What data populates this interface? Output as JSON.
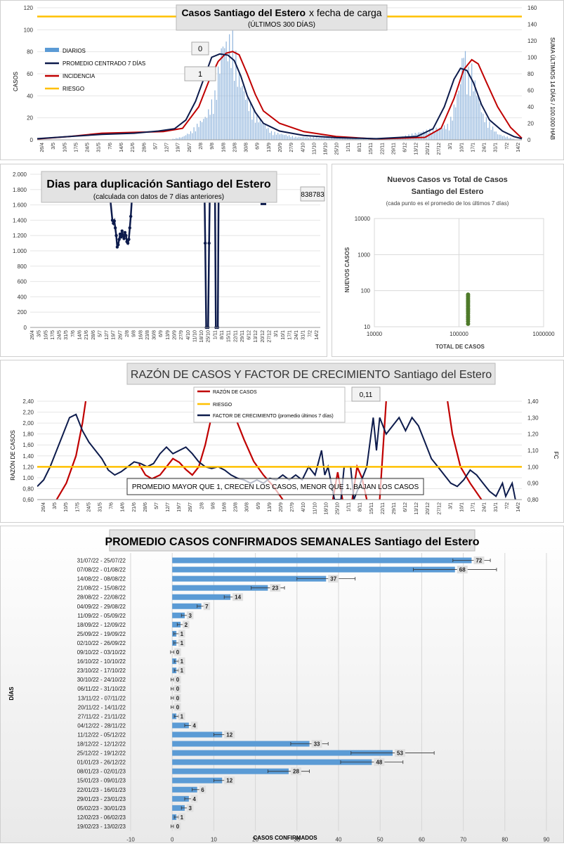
{
  "chart_data": [
    {
      "type": "bar",
      "title": "Casos Santiago del Estero",
      "title_suffix": "x fecha de carga",
      "subtitle": "(ÚLTIMOS 300 DÍAS)",
      "ylabel": "CASOS",
      "ylabel_right": "SUMA ÚLTIMOS 14 DÍAS / 100.000 HAB",
      "ylim": [
        0,
        120
      ],
      "ylim_right": [
        0,
        160
      ],
      "yticks": [
        "0",
        "20",
        "40",
        "60",
        "80",
        "100",
        "120"
      ],
      "yticks_right": [
        "0",
        "20",
        "40",
        "60",
        "80",
        "100",
        "120",
        "140",
        "160"
      ],
      "xtick_labels": [
        "26/4",
        "3/5",
        "10/5",
        "17/5",
        "24/5",
        "31/5",
        "7/6",
        "14/6",
        "21/6",
        "28/6",
        "5/7",
        "12/7",
        "19/7",
        "26/7",
        "2/8",
        "9/8",
        "16/8",
        "23/8",
        "30/8",
        "6/9",
        "13/9",
        "20/9",
        "27/9",
        "4/10",
        "11/10",
        "18/10",
        "25/10",
        "1/11",
        "8/11",
        "15/11",
        "22/11",
        "29/11",
        "6/12",
        "13/12",
        "20/12",
        "27/12",
        "3/1",
        "10/1",
        "17/1",
        "24/1",
        "31/1",
        "7/2",
        "14/2"
      ],
      "legend": [
        "DIARIOS",
        "PROMEDIO CENTRADO 7 DÍAS",
        "INCIDENCIA",
        "RIESGO"
      ],
      "annotations": [
        "0",
        "1"
      ],
      "riesgo": 112,
      "daily_peaks": [
        [
          84,
          1
        ],
        [
          90,
          3
        ],
        [
          95,
          8
        ],
        [
          105,
          25
        ],
        [
          110,
          45
        ],
        [
          113,
          80
        ],
        [
          115,
          100
        ],
        [
          118,
          95
        ],
        [
          121,
          105
        ],
        [
          124,
          70
        ],
        [
          127,
          55
        ],
        [
          130,
          40
        ],
        [
          135,
          25
        ],
        [
          145,
          8
        ],
        [
          160,
          3
        ],
        [
          220,
          1
        ],
        [
          255,
          15
        ],
        [
          260,
          45
        ],
        [
          262,
          60
        ],
        [
          264,
          100
        ],
        [
          266,
          65
        ],
        [
          269,
          70
        ],
        [
          272,
          50
        ],
        [
          276,
          25
        ],
        [
          285,
          6
        ],
        [
          295,
          1
        ]
      ],
      "avg_points": [
        [
          0,
          1
        ],
        [
          20,
          3
        ],
        [
          40,
          5
        ],
        [
          60,
          6
        ],
        [
          75,
          8
        ],
        [
          85,
          10
        ],
        [
          92,
          18
        ],
        [
          98,
          35
        ],
        [
          103,
          55
        ],
        [
          108,
          75
        ],
        [
          113,
          78
        ],
        [
          118,
          77
        ],
        [
          122,
          72
        ],
        [
          126,
          58
        ],
        [
          130,
          40
        ],
        [
          135,
          25
        ],
        [
          140,
          15
        ],
        [
          150,
          8
        ],
        [
          165,
          4
        ],
        [
          185,
          2
        ],
        [
          210,
          1
        ],
        [
          235,
          3
        ],
        [
          245,
          10
        ],
        [
          252,
          30
        ],
        [
          258,
          55
        ],
        [
          262,
          65
        ],
        [
          266,
          63
        ],
        [
          270,
          52
        ],
        [
          275,
          32
        ],
        [
          280,
          18
        ],
        [
          288,
          8
        ],
        [
          295,
          3
        ],
        [
          300,
          1
        ]
      ],
      "inc_points": [
        [
          0,
          1
        ],
        [
          20,
          4
        ],
        [
          40,
          8
        ],
        [
          60,
          9
        ],
        [
          78,
          10
        ],
        [
          90,
          14
        ],
        [
          100,
          40
        ],
        [
          106,
          70
        ],
        [
          112,
          95
        ],
        [
          117,
          105
        ],
        [
          121,
          107
        ],
        [
          125,
          103
        ],
        [
          130,
          80
        ],
        [
          135,
          55
        ],
        [
          140,
          35
        ],
        [
          150,
          20
        ],
        [
          165,
          10
        ],
        [
          185,
          4
        ],
        [
          210,
          1
        ],
        [
          240,
          3
        ],
        [
          250,
          14
        ],
        [
          258,
          50
        ],
        [
          264,
          85
        ],
        [
          269,
          97
        ],
        [
          273,
          92
        ],
        [
          278,
          70
        ],
        [
          285,
          40
        ],
        [
          293,
          15
        ],
        [
          300,
          2
        ]
      ]
    },
    {
      "type": "line",
      "title": "Dias para duplicación Santiago del Estero",
      "subtitle": "(calculada con datos de 7 días anteriores)",
      "annotation": "838783",
      "ylim": [
        0,
        2000
      ],
      "yticks": [
        "0",
        "200",
        "400",
        "600",
        "800",
        "1.000",
        "1.200",
        "1.400",
        "1.600",
        "1.800",
        "2.000"
      ],
      "xtick_labels": [
        "26/4",
        "3/5",
        "10/5",
        "17/5",
        "24/5",
        "31/5",
        "7/6",
        "14/6",
        "21/6",
        "28/6",
        "5/7",
        "12/7",
        "19/7",
        "26/7",
        "2/8",
        "9/8",
        "16/8",
        "23/8",
        "30/8",
        "6/9",
        "13/9",
        "20/9",
        "27/9",
        "4/10",
        "11/10",
        "18/10",
        "25/10",
        "1/11",
        "8/11",
        "15/11",
        "22/11",
        "29/11",
        "6/12",
        "13/12",
        "20/12",
        "27/12",
        "3/1",
        "10/1",
        "17/1",
        "24/1",
        "31/1",
        "7/2",
        "14/2"
      ],
      "segment_a": [
        [
          83,
          1650
        ],
        [
          85,
          1400
        ],
        [
          86,
          1360
        ],
        [
          87,
          1390
        ],
        [
          88,
          1300
        ],
        [
          89,
          1200
        ],
        [
          90,
          1050
        ],
        [
          91,
          1080
        ],
        [
          92,
          1150
        ],
        [
          93,
          1220
        ],
        [
          94,
          1180
        ],
        [
          95,
          1260
        ],
        [
          96,
          1200
        ],
        [
          97,
          1160
        ],
        [
          98,
          1240
        ],
        [
          99,
          1200
        ],
        [
          100,
          1120
        ],
        [
          101,
          1100
        ],
        [
          102,
          1150
        ],
        [
          103,
          1300
        ],
        [
          104,
          1450
        ],
        [
          105,
          1650
        ]
      ],
      "segment_b": [
        [
          180,
          2000
        ],
        [
          181,
          1100
        ],
        [
          182,
          0
        ],
        [
          184,
          0
        ],
        [
          185,
          1100
        ],
        [
          186,
          2000
        ]
      ],
      "segment_c": [
        [
          191,
          2000
        ],
        [
          192,
          0
        ],
        [
          194,
          0
        ],
        [
          195,
          2000
        ]
      ]
    },
    {
      "type": "scatter",
      "title": "Nuevos Casos vs Total de Casos Santiago del Estero",
      "subtitle": "(cada punto es el promedio de los últimos 7 días)",
      "xlabel": "TOTAL DE CASOS",
      "ylabel": "NUEVOS CASOS",
      "xscale": "log",
      "yscale": "log",
      "xlim": [
        10000,
        1000000
      ],
      "ylim": [
        10,
        10000
      ],
      "xticks": [
        "10000",
        "100000",
        "1000000"
      ],
      "yticks": [
        "10",
        "100",
        "1000",
        "10000"
      ],
      "x": 128000,
      "y": [
        12,
        14,
        16,
        18,
        20,
        23,
        26,
        29,
        32,
        36,
        40,
        45,
        50,
        55,
        62,
        70,
        78
      ]
    },
    {
      "type": "line",
      "title": "RAZÓN DE CASOS Y FACTOR DE CRECIMIENTO",
      "title_suffix": "Santiago del Estero",
      "ylabel": "RAZÓN DE CASOS",
      "ylabel_right": "FC",
      "ylim": [
        0.6,
        2.4
      ],
      "ylim_right": [
        0.8,
        1.4
      ],
      "yticks": [
        "0,60",
        "0,80",
        "1,00",
        "1,20",
        "1,40",
        "1,60",
        "1,80",
        "2,00",
        "2,20",
        "2,40"
      ],
      "yticks_right": [
        "0,80",
        "0,90",
        "1,00",
        "1,10",
        "1,20",
        "1,30",
        "1,40"
      ],
      "xtick_labels": [
        "26/4",
        "3/5",
        "10/5",
        "17/5",
        "24/5",
        "31/5",
        "7/6",
        "14/6",
        "21/6",
        "28/6",
        "5/7",
        "12/7",
        "19/7",
        "26/7",
        "2/8",
        "9/8",
        "16/8",
        "23/8",
        "30/8",
        "6/9",
        "13/9",
        "20/9",
        "27/9",
        "4/10",
        "11/10",
        "18/10",
        "25/10",
        "1/11",
        "8/11",
        "15/11",
        "22/11",
        "29/11",
        "6/12",
        "13/12",
        "20/12",
        "27/12",
        "3/1",
        "10/1",
        "17/1",
        "24/1",
        "31/1",
        "7/2",
        "14/2"
      ],
      "legend": [
        "RAZÓN DE CASOS",
        "RIESGO",
        "FACTOR DE CRECIMIENTO (promedio últimos 7 días)"
      ],
      "annotation": "0,11",
      "note": "PROMEDIO MAYOR QUE 1, CRECEN LOS CASOS, MENOR QUE 1, BAJAN LOS CASOS",
      "riesgo": 1.2,
      "razon_segments": [
        [
          [
            12,
            0.6
          ],
          [
            18,
            0.9
          ],
          [
            24,
            1.4
          ],
          [
            28,
            2.0
          ],
          [
            30,
            2.4
          ]
        ],
        [
          [
            63,
            1.25
          ],
          [
            67,
            1.05
          ],
          [
            71,
            0.98
          ],
          [
            76,
            1.05
          ],
          [
            80,
            1.2
          ],
          [
            84,
            1.35
          ],
          [
            88,
            1.28
          ],
          [
            92,
            1.15
          ],
          [
            96,
            1.05
          ],
          [
            100,
            1.2
          ],
          [
            104,
            1.6
          ],
          [
            107,
            2.0
          ],
          [
            109,
            2.4
          ]
        ],
        [
          [
            120,
            2.4
          ],
          [
            124,
            2.0
          ],
          [
            128,
            1.7
          ],
          [
            134,
            1.3
          ],
          [
            140,
            1.05
          ],
          [
            146,
            0.85
          ],
          [
            152,
            0.6
          ]
        ],
        [
          [
            183,
            0.6
          ],
          [
            186,
            1.1
          ],
          [
            189,
            0.6
          ]
        ],
        [
          [
            195,
            0.6
          ],
          [
            198,
            1.2
          ],
          [
            201,
            1.0
          ],
          [
            204,
            0.6
          ]
        ],
        [
          [
            212,
            0.6
          ],
          [
            214,
            1.5
          ],
          [
            216,
            2.4
          ]
        ],
        [
          [
            254,
            2.4
          ],
          [
            257,
            1.8
          ],
          [
            262,
            1.2
          ],
          [
            268,
            0.9
          ],
          [
            275,
            0.6
          ]
        ]
      ],
      "fc_points": [
        [
          0,
          0.88
        ],
        [
          4,
          0.92
        ],
        [
          8,
          1.0
        ],
        [
          12,
          1.1
        ],
        [
          16,
          1.2
        ],
        [
          20,
          1.3
        ],
        [
          24,
          1.32
        ],
        [
          28,
          1.22
        ],
        [
          32,
          1.15
        ],
        [
          36,
          1.1
        ],
        [
          40,
          1.05
        ],
        [
          44,
          0.98
        ],
        [
          48,
          0.95
        ],
        [
          52,
          0.97
        ],
        [
          56,
          1.0
        ],
        [
          60,
          1.03
        ],
        [
          64,
          1.02
        ],
        [
          68,
          1.0
        ],
        [
          72,
          1.02
        ],
        [
          76,
          1.08
        ],
        [
          80,
          1.12
        ],
        [
          84,
          1.08
        ],
        [
          88,
          1.1
        ],
        [
          92,
          1.12
        ],
        [
          96,
          1.08
        ],
        [
          100,
          1.03
        ],
        [
          104,
          1.0
        ],
        [
          108,
          0.99
        ],
        [
          112,
          1.0
        ],
        [
          116,
          0.98
        ],
        [
          120,
          0.95
        ],
        [
          124,
          0.93
        ],
        [
          128,
          0.92
        ],
        [
          132,
          0.9
        ],
        [
          136,
          0.92
        ],
        [
          140,
          0.9
        ],
        [
          144,
          0.93
        ],
        [
          148,
          0.92
        ],
        [
          152,
          0.95
        ],
        [
          156,
          0.92
        ],
        [
          160,
          0.95
        ],
        [
          164,
          0.92
        ],
        [
          168,
          1.0
        ],
        [
          172,
          0.95
        ],
        [
          176,
          1.1
        ],
        [
          178,
          0.95
        ],
        [
          180,
          1.0
        ],
        [
          184,
          0.8
        ],
        [
          188,
          0.8
        ],
        [
          190,
          1.0
        ],
        [
          194,
          1.0
        ],
        [
          196,
          0.8
        ],
        [
          200,
          0.9
        ],
        [
          204,
          1.0
        ],
        [
          208,
          1.3
        ],
        [
          210,
          1.1
        ],
        [
          212,
          1.3
        ],
        [
          216,
          1.2
        ],
        [
          220,
          1.25
        ],
        [
          224,
          1.3
        ],
        [
          228,
          1.22
        ],
        [
          232,
          1.3
        ],
        [
          236,
          1.25
        ],
        [
          240,
          1.15
        ],
        [
          244,
          1.05
        ],
        [
          248,
          1.0
        ],
        [
          252,
          0.95
        ],
        [
          256,
          0.9
        ],
        [
          260,
          0.88
        ],
        [
          264,
          0.92
        ],
        [
          268,
          0.98
        ],
        [
          272,
          0.95
        ],
        [
          276,
          0.9
        ],
        [
          280,
          0.85
        ],
        [
          284,
          0.82
        ],
        [
          288,
          0.9
        ],
        [
          290,
          0.82
        ],
        [
          294,
          0.9
        ],
        [
          296,
          0.8
        ]
      ]
    },
    {
      "type": "bar",
      "orientation": "horizontal",
      "title": "PROMEDIO CASOS CONFIRMADOS SEMANALES",
      "title_suffix": "Santiago del Estero",
      "xlabel": "CASOS CONFIRMADOS",
      "ylabel": "DÍAS",
      "xlim": [
        -10,
        90
      ],
      "xticks": [
        "-10",
        "0",
        "10",
        "20",
        "30",
        "40",
        "50",
        "60",
        "70",
        "80",
        "90"
      ],
      "categories": [
        "31/07/22 - 25/07/22",
        "07/08/22 - 01/08/22",
        "14/08/22 - 08/08/22",
        "21/08/22 - 15/08/22",
        "28/08/22 - 22/08/22",
        "04/09/22 - 29/08/22",
        "11/09/22 - 05/09/22",
        "18/09/22 - 12/09/22",
        "25/09/22 - 19/09/22",
        "02/10/22 - 26/09/22",
        "09/10/22 - 03/10/22",
        "16/10/22 - 10/10/22",
        "23/10/22 - 17/10/22",
        "30/10/22 - 24/10/22",
        "06/11/22 - 31/10/22",
        "13/11/22 - 07/11/22",
        "20/11/22 - 14/11/22",
        "27/11/22 - 21/11/22",
        "04/12/22 - 28/11/22",
        "11/12/22 - 05/12/22",
        "18/12/22 - 12/12/22",
        "25/12/22 - 19/12/22",
        "01/01/23 - 26/12/22",
        "08/01/23 - 02/01/23",
        "15/01/23 - 09/01/23",
        "22/01/23 - 16/01/23",
        "29/01/23 - 23/01/23",
        "05/02/23 - 30/01/23",
        "12/02/23 - 06/02/23",
        "19/02/23 - 13/02/23"
      ],
      "values": [
        72,
        68,
        37,
        23,
        14,
        7,
        3,
        2,
        1,
        1,
        0,
        1,
        1,
        0,
        0,
        0,
        0,
        1,
        4,
        12,
        33,
        53,
        48,
        28,
        12,
        6,
        4,
        3,
        1,
        0
      ],
      "errors": [
        4.5,
        10,
        7,
        4,
        1.5,
        1,
        0.8,
        0.8,
        0.6,
        0.6,
        0.4,
        0.5,
        0.5,
        0.3,
        0.3,
        0.3,
        0.3,
        0.5,
        1,
        2,
        4.5,
        10,
        7.5,
        5,
        2,
        1.2,
        1,
        0.8,
        0.5,
        0.3
      ]
    }
  ]
}
